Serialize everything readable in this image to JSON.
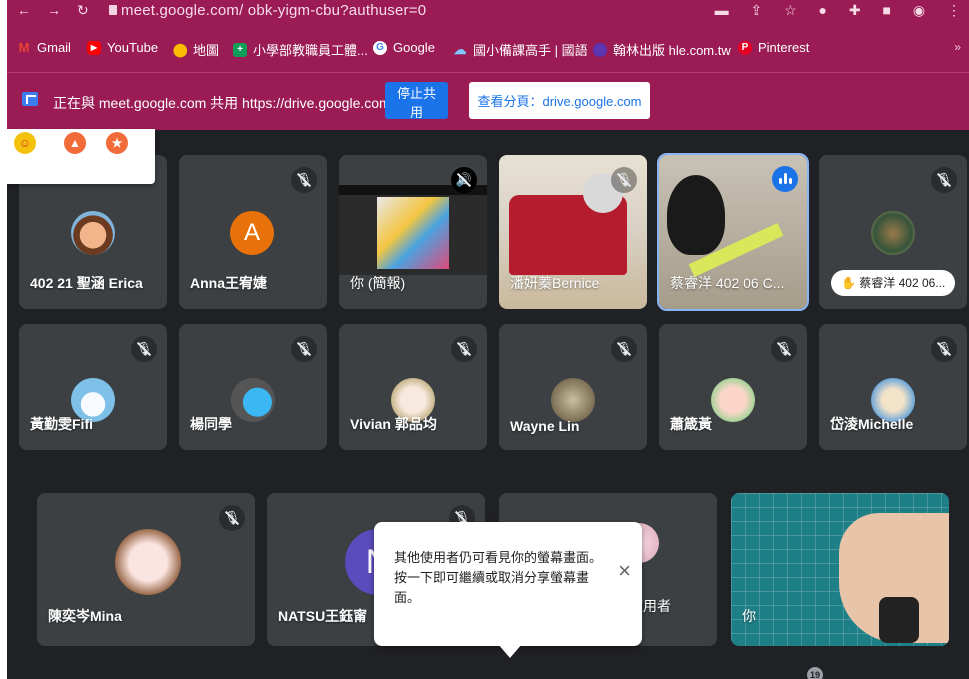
{
  "browser": {
    "url": "meet.google.com/ obk-yigm-cbu?authuser=0",
    "bookmarks": [
      {
        "label": "Gmail",
        "icon": "gmail-icon",
        "color": "#ea4335"
      },
      {
        "label": "YouTube",
        "icon": "youtube-icon",
        "color": "#ff0000"
      },
      {
        "label": "地圖",
        "icon": "maps-icon",
        "color": "#fbbc04"
      },
      {
        "label": "小學部教職員工體...",
        "icon": "classroom-icon",
        "color": "#0f9d58"
      },
      {
        "label": "Google",
        "icon": "google-icon",
        "color": "#ffffff"
      },
      {
        "label": "國小備課高手 | 國語",
        "icon": "cloud-icon",
        "color": "#4285f4"
      },
      {
        "label": "翰林出版 hle.com.tw",
        "icon": "hanlin-icon",
        "color": "#5e35b1"
      },
      {
        "label": "Pinterest",
        "icon": "pinterest-icon",
        "color": "#e60023"
      }
    ],
    "bookmarks_more": "»"
  },
  "share_bar": {
    "message": "正在與 meet.google.com 共用 https://drive.google.com",
    "stop_label": "停止共用",
    "view_label": "查看分頁：drive.google.com"
  },
  "participants": [
    {
      "name": "402 21 聖涵 Erica",
      "muted": false
    },
    {
      "name": "Anna王宥婕",
      "initial": "A",
      "muted": true
    },
    {
      "name": "你 (簡報)",
      "muted": true
    },
    {
      "name": "潘妍蓁Bernice",
      "muted": true
    },
    {
      "name": "蔡睿洋 402 06 C...",
      "speaking": true
    },
    {
      "name": "",
      "hand_label": "蔡睿洋 402 06...",
      "muted": true
    },
    {
      "name": "黃勤雯Fifi",
      "muted": true
    },
    {
      "name": "楊同學",
      "muted": true
    },
    {
      "name": "Vivian 郭品均",
      "muted": true
    },
    {
      "name": "Wayne Lin",
      "muted": true
    },
    {
      "name": "蕭箴黃",
      "muted": true
    },
    {
      "name": "岱淩Michelle",
      "muted": true
    },
    {
      "name": "陳奕岑Mina",
      "muted": true
    },
    {
      "name": "NATSU王鈺甯",
      "initial": "N",
      "muted": true
    },
    {
      "name": "使用者",
      "muted": false
    },
    {
      "name": "你",
      "muted": false
    }
  ],
  "tooltip": {
    "message": "其他使用者仍可看見你的螢幕畫面。按一下即可繼續或取消分享螢幕畫面。",
    "close": "×"
  },
  "participant_count": "19"
}
